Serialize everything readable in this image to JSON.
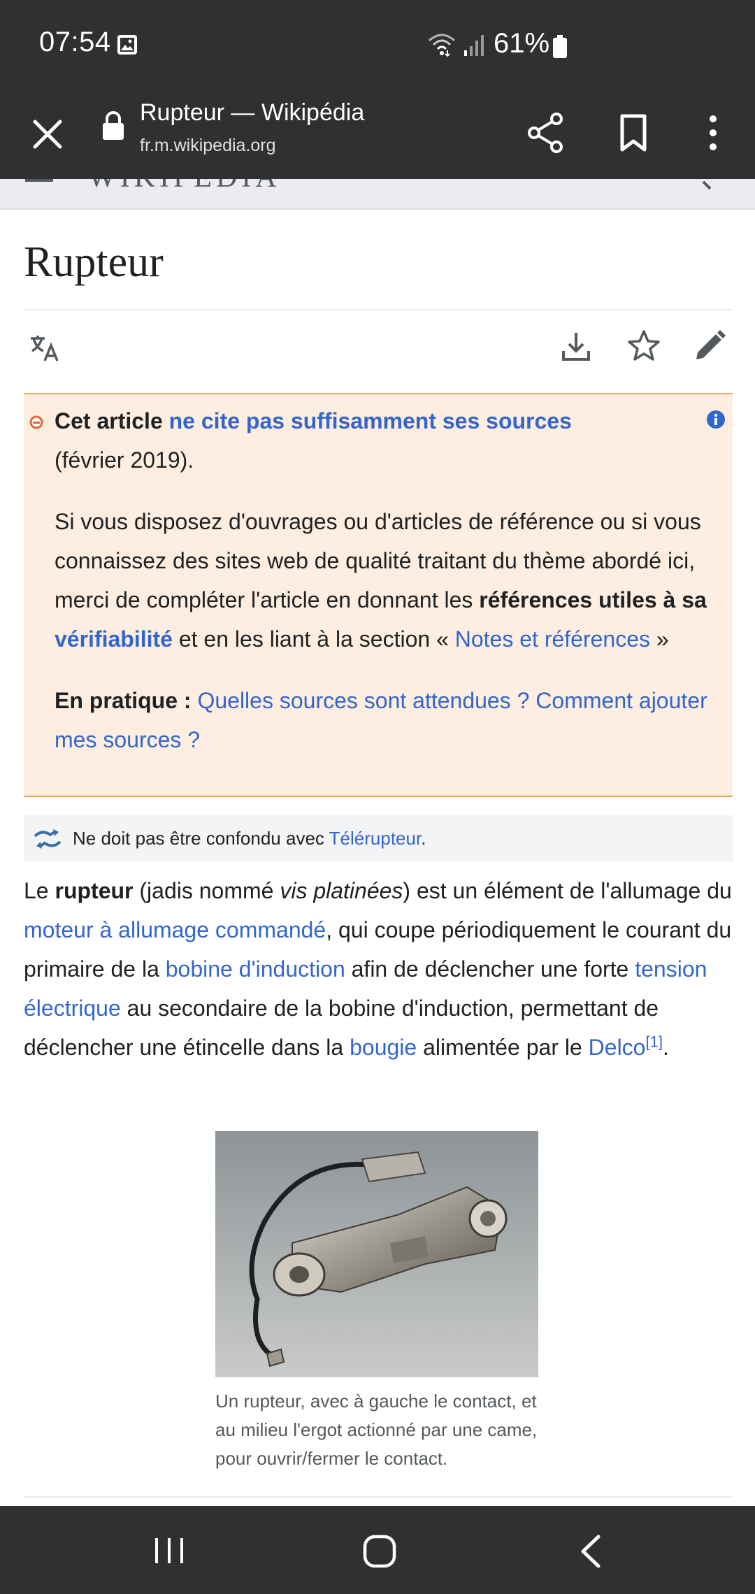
{
  "status_bar": {
    "time": "07:54",
    "battery": "61%"
  },
  "browser": {
    "tab_title": "Rupteur — Wikipédia",
    "url": "fr.m.wikipedia.org"
  },
  "wiki_header": {
    "wordmark": "WIKIPÉDIA"
  },
  "article": {
    "title": "Rupteur"
  },
  "ambox": {
    "lead_bold": "Cet article",
    "lead_link": "ne cite pas suffisamment ses sources",
    "date": "(février 2019).",
    "p2_text1": "Si vous disposez d'ouvrages ou d'articles de référence ou si vous connaissez des sites web de qualité traitant du thème abordé ici, merci de compléter l'article en donnant les ",
    "p2_bold": "références utiles à sa ",
    "p2_link": "vérifiabilité",
    "p2_text2": " et en les liant à la section « ",
    "p2_link2": "Notes et références",
    "p2_text3": " »",
    "p3_bold": "En pratique : ",
    "p3_link1": "Quelles sources sont attendues ?",
    "p3_link2": "Comment ajouter mes sources ?"
  },
  "hatnote": {
    "text": "Ne doit pas être confondu avec ",
    "link": "Télérupteur",
    "end": "."
  },
  "lead": {
    "t1": "Le ",
    "b1": "rupteur",
    "t2": " (jadis nommé ",
    "i1": "vis platinées",
    "t3": ") est un élément de l'allumage du ",
    "l1": "moteur à allumage commandé",
    "t4": ", qui coupe périodiquement le courant du primaire de la ",
    "l2": "bobine d'induction",
    "t5": " afin de déclencher une forte ",
    "l3": "tension électrique",
    "t6": " au secondaire de la bobine d'induction, permettant de déclencher une étincelle dans la ",
    "l4": "bougie",
    "t7": " alimentée par le ",
    "l5": "Delco",
    "ref": "[1]",
    "t8": "."
  },
  "figure": {
    "caption": "Un rupteur, avec à gauche le contact, et au milieu l'ergot actionné par une came, pour ouvrir/fermer le contact."
  },
  "colors": {
    "chrome": "#2f3032",
    "link": "#3366cc",
    "ambox_bg": "#fdeee1",
    "ambox_border": "#e8a55c"
  }
}
